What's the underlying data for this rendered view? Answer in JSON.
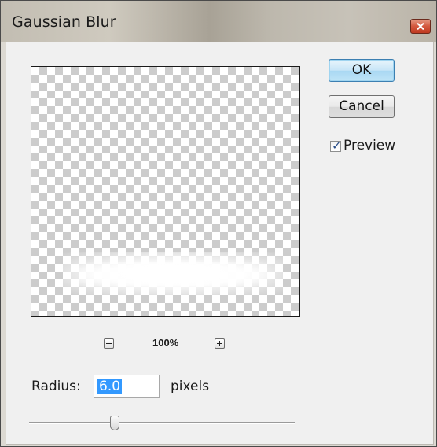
{
  "window": {
    "title": "Gaussian Blur"
  },
  "buttons": {
    "ok_label": "OK",
    "cancel_label": "Cancel"
  },
  "preview_option": {
    "label": "Preview",
    "checked": true,
    "check_glyph": "✓"
  },
  "zoom": {
    "level": "100%",
    "zoom_out_icon": "minus-icon",
    "zoom_in_icon": "plus-icon"
  },
  "radius": {
    "label": "Radius:",
    "value": "6.0",
    "units": "pixels"
  },
  "colors": {
    "selection_highlight": "#3399ff",
    "ok_button_accent": "#a9d8f3",
    "close_button": "#d3573d"
  }
}
